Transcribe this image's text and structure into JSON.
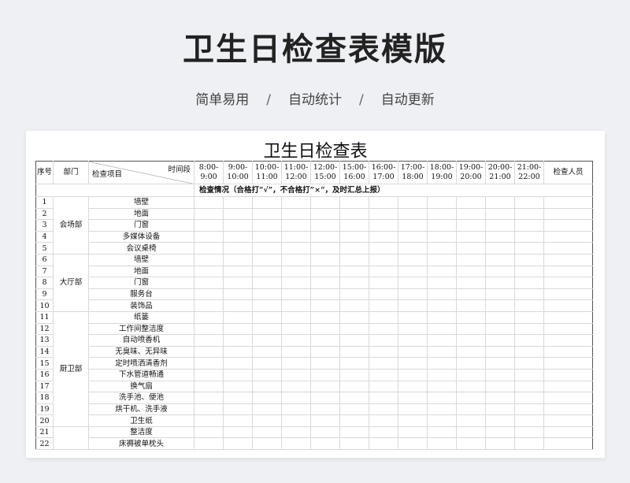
{
  "hero": {
    "title": "卫生日检查表模版",
    "features": [
      "简单易用",
      "自动统计",
      "自动更新"
    ],
    "separator": "/"
  },
  "sheet": {
    "title": "卫生日检查表",
    "headers": {
      "seq": "序号",
      "dept": "部门",
      "item": "检查项目",
      "period": "时间段",
      "inspector": "检查人员"
    },
    "time_slots": [
      [
        "8:00-",
        "9:00"
      ],
      [
        "9:00-",
        "10:00"
      ],
      [
        "10:00-",
        "11:00"
      ],
      [
        "11:00-",
        "12:00"
      ],
      [
        "12:00-",
        "15:00"
      ],
      [
        "15:00-",
        "16:00"
      ],
      [
        "16:00-",
        "17:00"
      ],
      [
        "17:00-",
        "18:00"
      ],
      [
        "18:00-",
        "19:00"
      ],
      [
        "19:00-",
        "20:00"
      ],
      [
        "20:00-",
        "21:00"
      ],
      [
        "21:00-",
        "22:00"
      ]
    ],
    "note": "检查情况（合格打“√”，不合格打”×“，及时汇总上报）",
    "groups": [
      {
        "dept": "会场部",
        "start": 1,
        "count": 5
      },
      {
        "dept": "大厅部",
        "start": 6,
        "count": 5
      },
      {
        "dept": "厨卫部",
        "start": 11,
        "count": 10
      },
      {
        "dept": "",
        "start": 21,
        "count": 2
      }
    ],
    "rows": [
      {
        "no": "1",
        "item": "墙壁"
      },
      {
        "no": "2",
        "item": "地面"
      },
      {
        "no": "3",
        "item": "门窗"
      },
      {
        "no": "4",
        "item": "多媒体设备"
      },
      {
        "no": "5",
        "item": "会议桌椅"
      },
      {
        "no": "6",
        "item": "墙壁"
      },
      {
        "no": "7",
        "item": "地面"
      },
      {
        "no": "8",
        "item": "门窗"
      },
      {
        "no": "9",
        "item": "服务台"
      },
      {
        "no": "10",
        "item": "装饰品"
      },
      {
        "no": "11",
        "item": "纸篓"
      },
      {
        "no": "12",
        "item": "工作间整洁度"
      },
      {
        "no": "13",
        "item": "自动喷香机"
      },
      {
        "no": "14",
        "item": "无臭味、无异味"
      },
      {
        "no": "15",
        "item": "定时喷洒清香剂"
      },
      {
        "no": "16",
        "item": "下水管道畅通"
      },
      {
        "no": "17",
        "item": "换气扇"
      },
      {
        "no": "18",
        "item": "洗手池、便池"
      },
      {
        "no": "19",
        "item": "烘干机、洗手液"
      },
      {
        "no": "20",
        "item": "卫生纸"
      },
      {
        "no": "21",
        "item": "整洁度"
      },
      {
        "no": "22",
        "item": "床褥被单枕头"
      }
    ]
  }
}
